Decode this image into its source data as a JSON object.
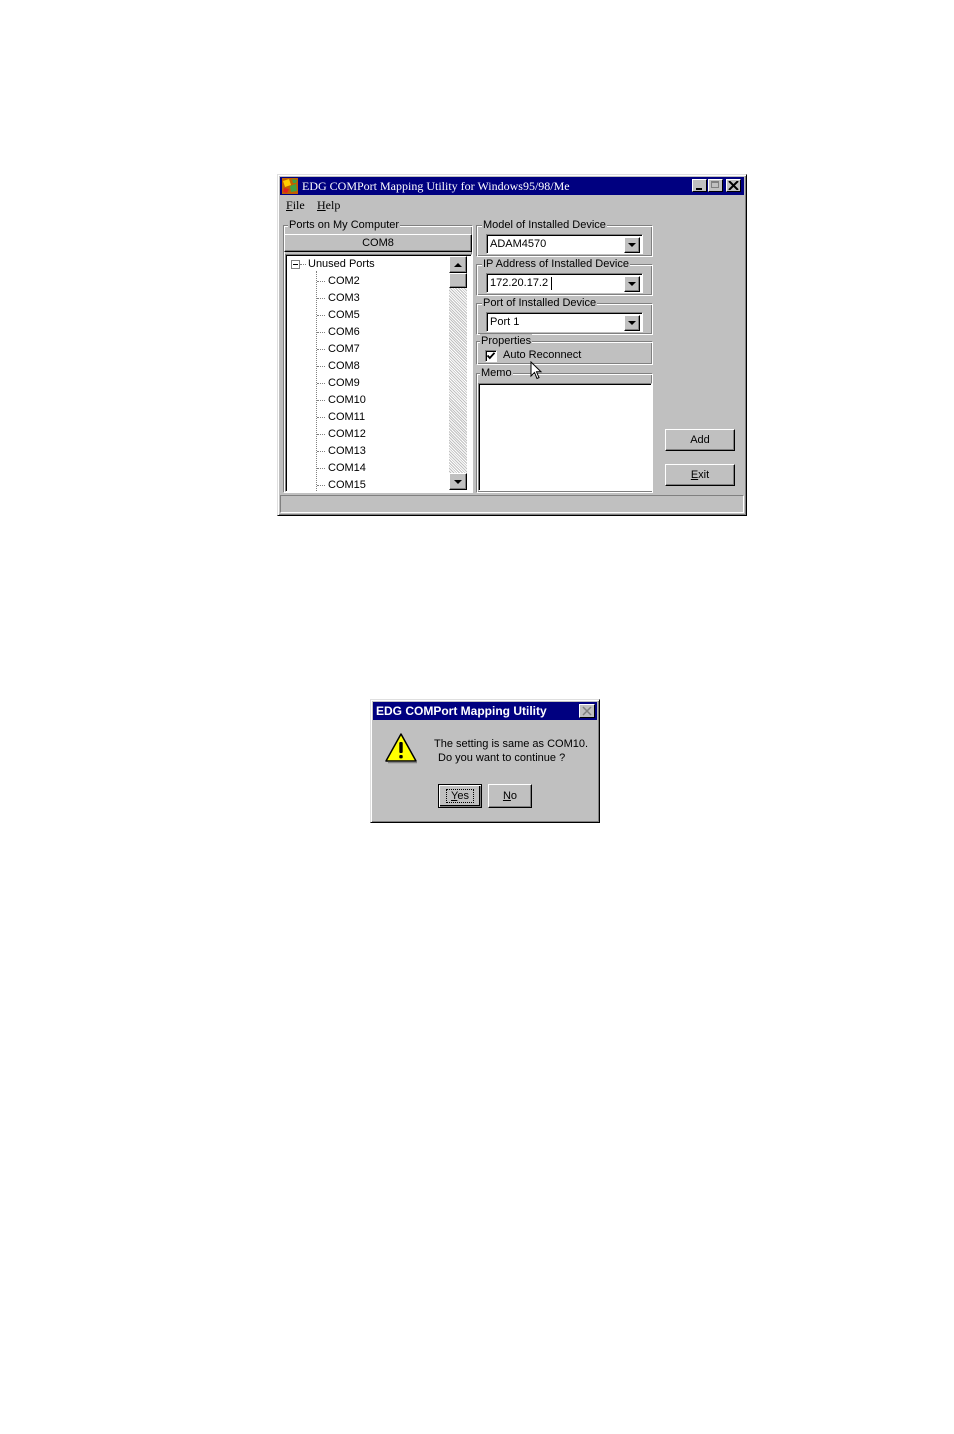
{
  "main_window": {
    "title": "EDG COMPort Mapping Utility for Windows95/98/Me",
    "controls": [
      "minimize",
      "maximize",
      "close"
    ],
    "menu": [
      {
        "label": "File",
        "mnemonic": "F",
        "rest": "ile"
      },
      {
        "label": "Help",
        "mnemonic": "H",
        "rest": "elp"
      }
    ],
    "ports_group": {
      "label": "Ports on My Computer",
      "selected_port": "COM8",
      "tree_root": "Unused Ports",
      "tree_items": [
        "COM2",
        "COM3",
        "COM5",
        "COM6",
        "COM7",
        "COM8",
        "COM9",
        "COM10",
        "COM11",
        "COM12",
        "COM13",
        "COM14",
        "COM15"
      ]
    },
    "model_group": {
      "label": "Model of Installed Device",
      "value": "ADAM4570"
    },
    "ip_group": {
      "label": "IP Address of Installed Device",
      "value": "172.20.17.2"
    },
    "port_group": {
      "label": "Port of Installed Device",
      "value": "Port 1"
    },
    "properties_group": {
      "label": "Properties",
      "auto_reconnect_label": "Auto Reconnect",
      "auto_reconnect_checked": true
    },
    "memo_group": {
      "label": "Memo",
      "value": ""
    },
    "buttons": {
      "add": "Add",
      "exit": {
        "label": "Exit",
        "mnemonic": "E",
        "rest": "xit"
      }
    },
    "status_bar": ""
  },
  "dialog": {
    "title": "EDG COMPort Mapping Utility",
    "icon": "warning-icon",
    "message_line1": "The setting is same as COM10.",
    "message_line2": "Do you want to continue ?",
    "yes": {
      "label": "Yes",
      "mnemonic": "Y",
      "rest": "es"
    },
    "no": {
      "label": "No",
      "mnemonic": "N",
      "rest": "o"
    }
  },
  "colors": {
    "title_bar": "#000080",
    "face": "#c0c0c0",
    "warning_yellow": "#ffff00"
  }
}
